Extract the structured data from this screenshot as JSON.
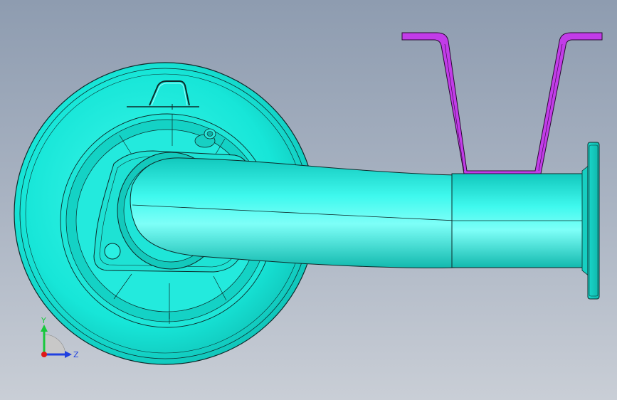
{
  "viewport": {
    "background_top": "#8e9cb0",
    "background_bottom": "#c9ced6"
  },
  "model": {
    "body_color": "#19f0e0",
    "edge_color": "#0d2a2a",
    "bracket_color": "#c23ce8"
  },
  "triad": {
    "y_label": "Y",
    "z_label": "Z",
    "y_color": "#18c83c",
    "z_color": "#2040e0",
    "x_color": "#e01818"
  }
}
